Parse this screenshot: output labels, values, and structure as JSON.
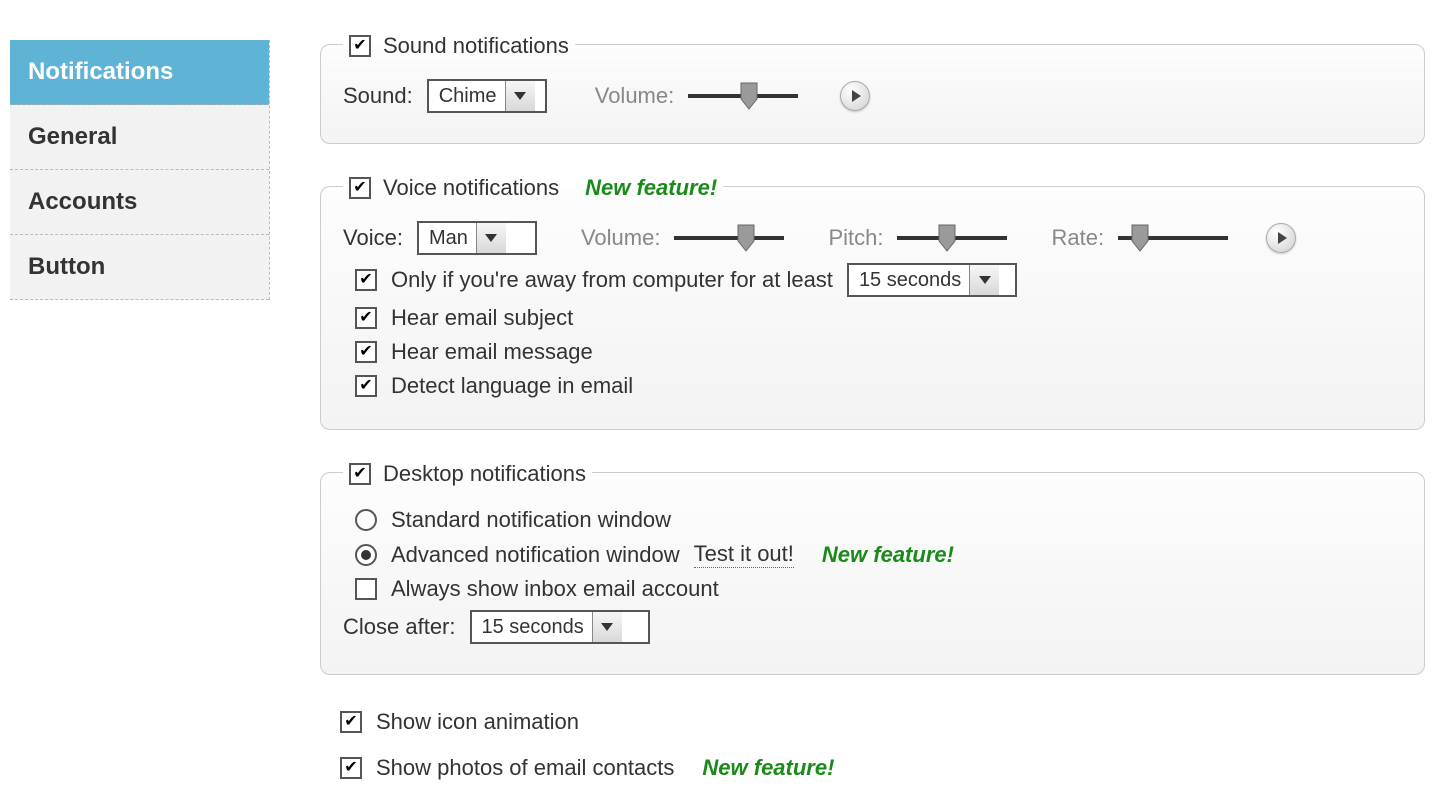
{
  "sidebar": {
    "items": [
      {
        "label": "Notifications",
        "active": true
      },
      {
        "label": "General",
        "active": false
      },
      {
        "label": "Accounts",
        "active": false
      },
      {
        "label": "Button",
        "active": false
      }
    ]
  },
  "badges": {
    "new_feature": "New feature!"
  },
  "sound": {
    "enabled": true,
    "title": "Sound notifications",
    "sound_label": "Sound:",
    "sound_value": "Chime",
    "volume_label": "Volume:",
    "volume_pct": 55
  },
  "voice": {
    "enabled": true,
    "title": "Voice notifications",
    "voice_label": "Voice:",
    "voice_value": "Man",
    "volume_label": "Volume:",
    "volume_pct": 65,
    "pitch_label": "Pitch:",
    "pitch_pct": 45,
    "rate_label": "Rate:",
    "rate_pct": 20,
    "away": {
      "enabled": true,
      "label": "Only if you're away from computer for at least",
      "value": "15 seconds"
    },
    "hear_subject": {
      "enabled": true,
      "label": "Hear email subject"
    },
    "hear_message": {
      "enabled": true,
      "label": "Hear email message"
    },
    "detect_lang": {
      "enabled": true,
      "label": "Detect language in email"
    }
  },
  "desktop": {
    "enabled": true,
    "title": "Desktop notifications",
    "mode": "advanced",
    "standard_label": "Standard notification window",
    "advanced_label": "Advanced notification window",
    "test_link": "Test it out!",
    "always_show": {
      "enabled": false,
      "label": "Always show inbox email account"
    },
    "close_after_label": "Close after:",
    "close_after_value": "15 seconds"
  },
  "misc": {
    "icon_anim": {
      "enabled": true,
      "label": "Show icon animation"
    },
    "show_photos": {
      "enabled": true,
      "label": "Show photos of email contacts"
    }
  }
}
